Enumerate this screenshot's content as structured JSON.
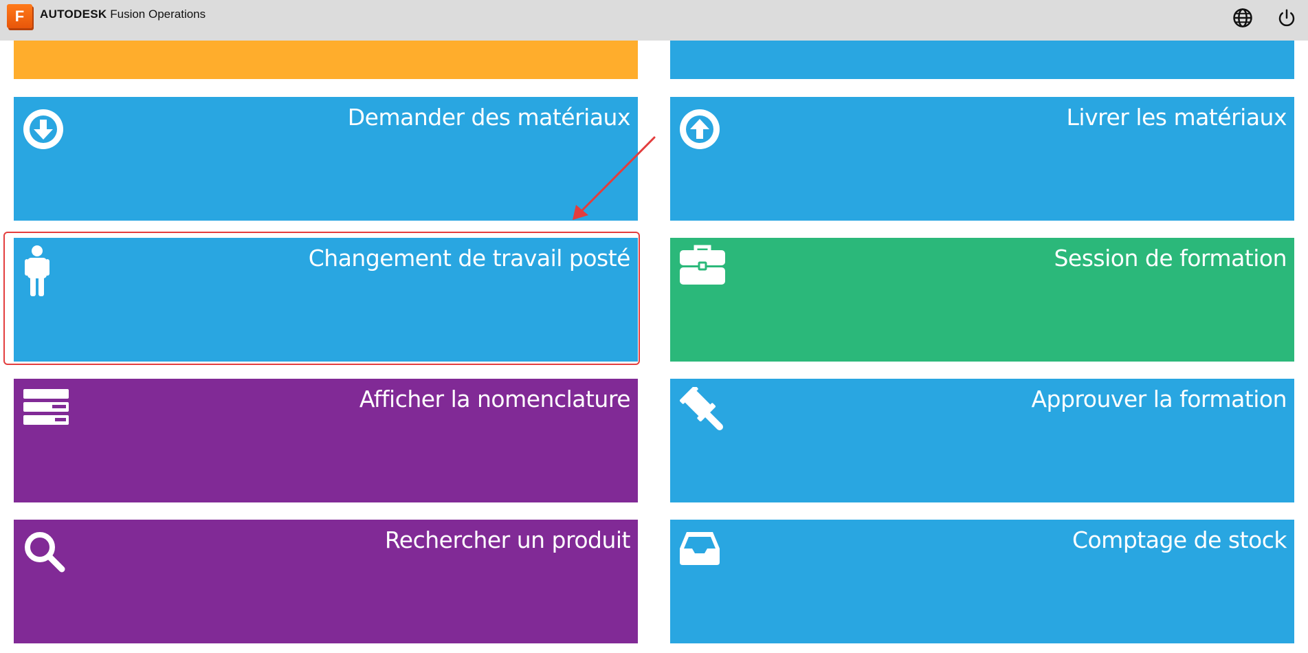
{
  "app": {
    "logo_letter": "F",
    "brand_bold": "AUTODESK",
    "brand_name": "Fusion Operations"
  },
  "topbar": {
    "icons": [
      "globe-icon",
      "power-icon"
    ]
  },
  "tiles": [
    {
      "label": "",
      "color": "#ffad2c"
    },
    {
      "label": "",
      "color": "#29a6e1"
    },
    {
      "label": "Demander des matériaux",
      "icon": "arrow-down-circle-icon",
      "color": "#29a6e1"
    },
    {
      "label": "Livrer les matériaux",
      "icon": "arrow-up-circle-icon",
      "color": "#29a6e1"
    },
    {
      "label": "Changement de travail posté",
      "icon": "person-icon",
      "color": "#29a6e1",
      "highlighted": true
    },
    {
      "label": "Session de formation",
      "icon": "briefcase-icon",
      "color": "#2bb87a"
    },
    {
      "label": "Afficher la nomenclature",
      "icon": "list-icon",
      "color": "#812a96"
    },
    {
      "label": "Approuver la formation",
      "icon": "gavel-icon",
      "color": "#29a6e1"
    },
    {
      "label": "Rechercher un produit",
      "icon": "search-icon",
      "color": "#812a96"
    },
    {
      "label": "Comptage de stock",
      "icon": "inbox-icon",
      "color": "#29a6e1"
    }
  ],
  "colors": {
    "topbar_bg": "#dcdcdc",
    "annotation_red": "#e33d3d"
  }
}
